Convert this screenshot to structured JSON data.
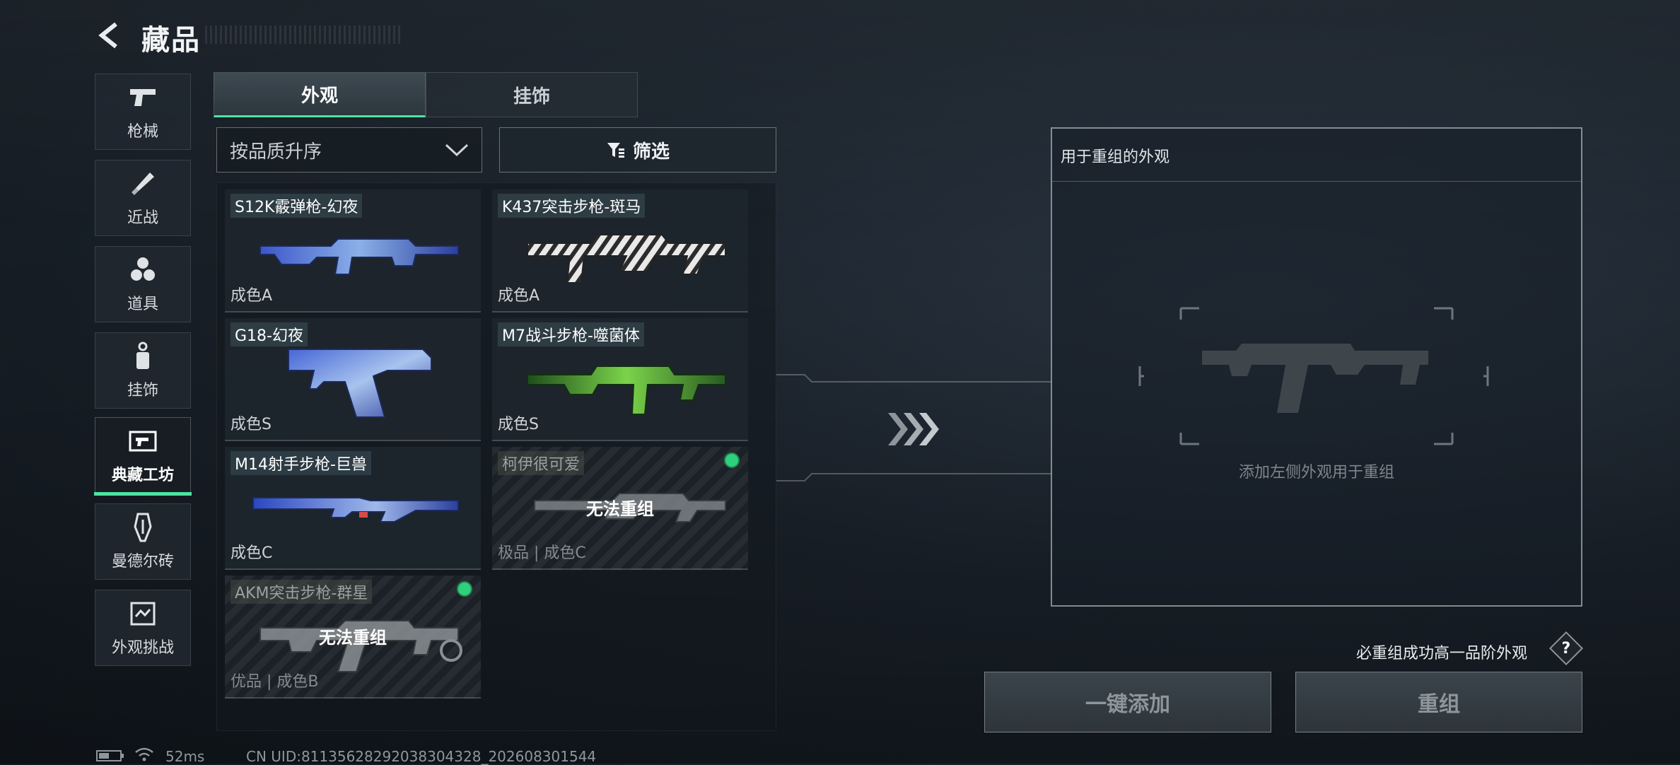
{
  "header": {
    "title": "藏品"
  },
  "sidebar": {
    "items": [
      {
        "label": "枪械",
        "icon": "pistol-icon"
      },
      {
        "label": "近战",
        "icon": "knife-icon"
      },
      {
        "label": "道具",
        "icon": "grenades-icon"
      },
      {
        "label": "挂饰",
        "icon": "charm-icon"
      },
      {
        "label": "典藏工坊",
        "icon": "workshop-icon",
        "active": true
      },
      {
        "label": "曼德尔砖",
        "icon": "brick-icon"
      },
      {
        "label": "外观挑战",
        "icon": "challenge-icon"
      }
    ]
  },
  "tabs": [
    {
      "label": "外观",
      "active": true
    },
    {
      "label": "挂饰",
      "active": false
    }
  ],
  "sort": {
    "value": "按品质升序"
  },
  "filter": {
    "label": "筛选"
  },
  "items": [
    {
      "name": "S12K霰弹枪-幻夜",
      "grade": "成色A",
      "skin": "blue-swirl",
      "locked": false
    },
    {
      "name": "K437突击步枪-斑马",
      "grade": "成色A",
      "skin": "zebra",
      "locked": false
    },
    {
      "name": "G18-幻夜",
      "grade": "成色S",
      "skin": "blue-swirl",
      "locked": false
    },
    {
      "name": "M7战斗步枪-噬菌体",
      "grade": "成色S",
      "skin": "green-bio",
      "locked": false
    },
    {
      "name": "M14射手步枪-巨兽",
      "grade": "成色C",
      "skin": "blue-swirl",
      "locked": false
    },
    {
      "name": "柯伊很可爱",
      "grade": "极品 | 成色C",
      "skin": "grey",
      "locked": true,
      "lock_text": "无法重组"
    },
    {
      "name": "AKM突击步枪-群星",
      "grade": "优品 | 成色B",
      "skin": "grey",
      "locked": true,
      "lock_text": "无法重组"
    }
  ],
  "recombine": {
    "panel_title": "用于重组的外观",
    "hint": "添加左侧外观用于重组",
    "guarantee": "必重组成功高一品阶外观",
    "help_label": "?",
    "add_all_label": "一键添加",
    "recombine_label": "重组"
  },
  "status": {
    "ping": "52ms",
    "uid": "CN UID:8113562829203830432​8_202608301544"
  },
  "colors": {
    "accent": "#4ee3a2",
    "available_dot": "#2fd07c"
  }
}
